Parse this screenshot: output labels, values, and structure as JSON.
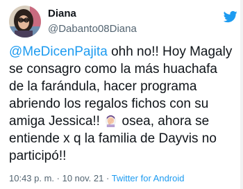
{
  "tweet": {
    "display_name": "Diana",
    "handle": "@Dabanto08Diana",
    "mention": "@MeDicenPajita",
    "lines": [
      " ohh no!! Hoy Magaly",
      "se consagro como la más huachafa",
      "de la farándula, hacer programa",
      "abriendo los regalos fichos con su",
      "amiga Jessica!! ",
      " osea, ahora se",
      "entiende x q la familia de Dayvis no",
      "participó!!"
    ],
    "emoji": "woman-facepalming-emoji",
    "time": "10:43 p. m.",
    "separator": " · ",
    "date": "10 nov. 21",
    "source": "Twitter for Android"
  },
  "colors": {
    "accent": "#1d9bf0",
    "text": "#0f1419",
    "secondary": "#536471"
  },
  "icons": {
    "brand": "twitter-bird-icon"
  }
}
